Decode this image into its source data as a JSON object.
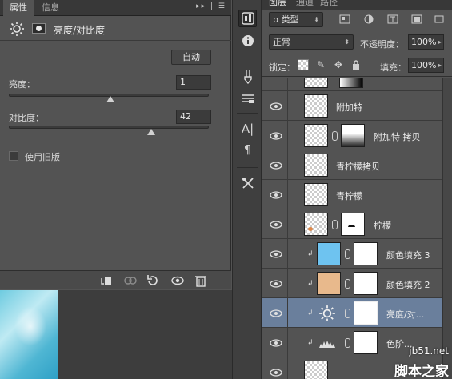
{
  "properties_panel": {
    "tabs": [
      "属性",
      "信息"
    ],
    "header_title": "亮度/对比度",
    "auto_button": "自动",
    "brightness": {
      "label": "亮度：",
      "value": "1",
      "slider_fraction": 0.506
    },
    "contrast": {
      "label": "对比度：",
      "value": "42",
      "slider_fraction": 0.71
    },
    "legacy_label": "使用旧版",
    "legacy_checked": false
  },
  "layers_panel": {
    "tabs": [
      "图层",
      "通道",
      "路径"
    ],
    "filter_label": "ρ 类型",
    "blend_mode": "正常",
    "opacity_label": "不透明度：",
    "opacity_value": "100%",
    "lock_label": "锁定：",
    "fill_label": "填充：",
    "fill_value": "100%",
    "layers": [
      {
        "name": "",
        "type": "gradient",
        "selected": false
      },
      {
        "name": "附加特",
        "type": "pixel",
        "selected": false
      },
      {
        "name": "附加特 拷贝",
        "type": "pixel-mask",
        "selected": false
      },
      {
        "name": "青柠檬拷贝",
        "type": "pixel",
        "selected": false
      },
      {
        "name": "青柠檬",
        "type": "pixel",
        "selected": false
      },
      {
        "name": "柠檬",
        "type": "pixel-mask",
        "selected": false
      },
      {
        "name": "颜色填充 3",
        "type": "fill",
        "color": "#6ec3f0",
        "clipped": true,
        "selected": false
      },
      {
        "name": "颜色填充 2",
        "type": "fill",
        "color": "#e8b98c",
        "clipped": true,
        "selected": false
      },
      {
        "name": "亮度/对...",
        "type": "brightness",
        "clipped": true,
        "selected": true
      },
      {
        "name": "色阶...",
        "type": "levels",
        "clipped": true,
        "selected": false
      },
      {
        "name": "",
        "type": "pixel",
        "selected": false
      }
    ]
  },
  "watermark": {
    "url": "jb51.net",
    "text": "脚本之家"
  },
  "colors": {
    "panel": "#535353",
    "selection": "#6a7f9c",
    "fill3": "#6ec3f0",
    "fill2": "#e8b98c"
  }
}
